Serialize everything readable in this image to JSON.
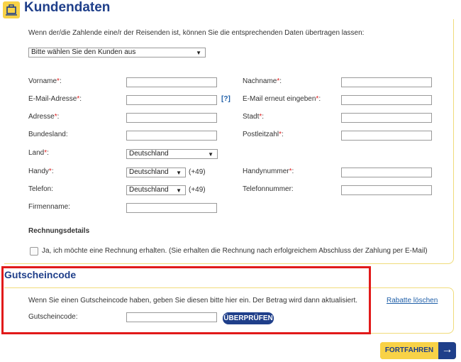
{
  "header": {
    "title": "Kundendaten",
    "icon": "suitcase-icon"
  },
  "intro": "Wenn der/die Zahlende eine/r der Reisenden ist, können Sie die entsprechenden Daten übertragen lassen:",
  "customer_select": {
    "value": "Bitte wählen Sie den Kunden aus"
  },
  "form": {
    "firstname_label": "Vorname",
    "lastname_label": "Nachname",
    "email_label": "E-Mail-Adresse",
    "email_help": "[?]",
    "email_repeat_label": "E-Mail erneut eingeben",
    "address_label": "Adresse",
    "city_label": "Stadt",
    "state_label": "Bundesland",
    "zip_label": "Postleitzahl",
    "country_label": "Land",
    "country_value": "Deutschland",
    "mobile_label": "Handy",
    "mobile_country": "Deutschland",
    "mobile_prefix": "(+49)",
    "mobile_number_label": "Handynummer",
    "phone_label": "Telefon",
    "phone_country": "Deutschland",
    "phone_prefix": "(+49)",
    "phone_number_label": "Telefonnummer:",
    "company_label": "Firmenname:",
    "required_mark": "*"
  },
  "invoice": {
    "heading": "Rechnungsdetails",
    "checkbox_label": "Ja, ich möchte eine Rechnung erhalten. (Sie erhalten die Rechnung nach erfolgreichem Abschluss der Zahlung per E-Mail)"
  },
  "voucher": {
    "title": "Gutscheincode",
    "intro": "Wenn Sie einen Gutscheincode haben, geben Sie diesen bitte hier ein. Der Betrag wird dann aktualisiert.",
    "remove_link": "Rabatte löschen",
    "code_label": "Gutscheincode:",
    "check_button": "ÜBERPRÜFEN"
  },
  "footer": {
    "next_button": "FORTFAHREN",
    "arrow_icon": "arrow-right-icon"
  },
  "colors": {
    "brand_blue": "#1f3f8a",
    "accent_yellow": "#f8d247",
    "highlight_red": "#e11a1a"
  }
}
